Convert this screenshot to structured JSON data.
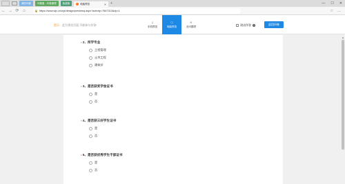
{
  "browser": {
    "tabs": [
      {
        "label": "我的问卷",
        "color": "#7fb2e5"
      },
      {
        "label": "问卷星 - 问卷管理",
        "color": "#5fa85f"
      },
      {
        "label": "免费版",
        "color": "#4fa07a"
      },
      {
        "label": "电脑预览",
        "active": true
      }
    ],
    "address": "https://www.wjx.cn/wjx/design/previewq.aspx?activity=7667313&dp=1",
    "new_tab": "+",
    "back": "←",
    "forward": "→",
    "refresh": "⟳",
    "home": "⌂",
    "lock": "🔒",
    "minimize": "—",
    "maximize": "☐",
    "close": "✕",
    "star": "☆",
    "more": "…"
  },
  "toolbar": {
    "tip_label": "提示:",
    "tip_text": "此为预览页面,不能参与作答!",
    "modes": [
      {
        "label": "手机预览",
        "icon": "▯"
      },
      {
        "label": "电脑预览",
        "icon": "🖵",
        "active": true
      },
      {
        "label": "无问题项",
        "icon": "⊙"
      }
    ],
    "test_mode": "测试作答",
    "help": "?",
    "back_button": "返回问卷"
  },
  "questions": [
    {
      "number": "2、",
      "title": "所学专业",
      "required": "*",
      "options": [
        "工程管理",
        "土木工程",
        "建筑学"
      ]
    },
    {
      "number": "3、",
      "title": "是否获奖学金证书",
      "required": "*",
      "options": [
        "是",
        "否"
      ]
    },
    {
      "number": "4、",
      "title": "是否获三好学生证书",
      "required": "*",
      "options": [
        "是",
        "否"
      ]
    },
    {
      "number": "5、",
      "title": "是否获优秀学生干部证书",
      "required": "*",
      "options": [
        "是",
        "否"
      ]
    }
  ],
  "colors": {
    "accent": "#1e88e5",
    "required": "#e53935",
    "tip": "#f39a2b"
  }
}
